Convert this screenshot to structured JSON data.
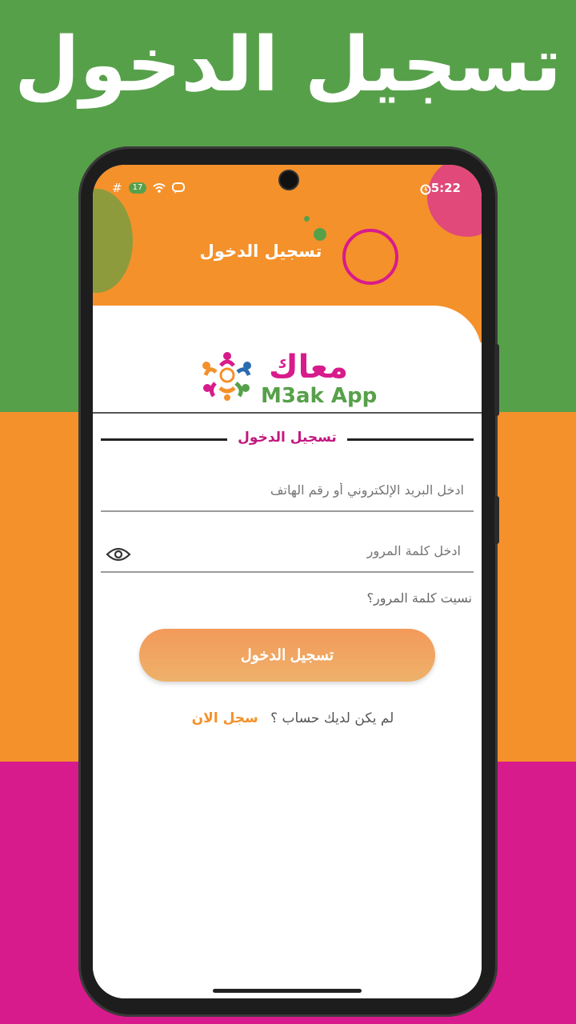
{
  "banner": {
    "title": "تسجيل الدخول"
  },
  "status_bar": {
    "time": "5:22",
    "badge": "17",
    "symbol": "#"
  },
  "header": {
    "title": "تسجيل الدخول"
  },
  "logo": {
    "arabic_name": "معاك",
    "english_name": "M3ak App"
  },
  "form": {
    "section_title": "تسجيل الدخول",
    "email_placeholder": "ادخل البريد الإلكتروني أو رقم الهاتف",
    "password_placeholder": "ادخل كلمة المرور",
    "forgot_password": "نسيت كلمة المرور؟",
    "login_button": "تسجيل الدخول",
    "no_account_text": "لم يكن لديك حساب ؟",
    "register_link": "سجل الان"
  },
  "colors": {
    "green": "#57a04a",
    "orange": "#f4912b",
    "pink": "#d81b8c"
  },
  "icons": [
    "wifi-icon",
    "chat-icon",
    "alarm-icon",
    "eye-icon",
    "people-logo-icon"
  ]
}
